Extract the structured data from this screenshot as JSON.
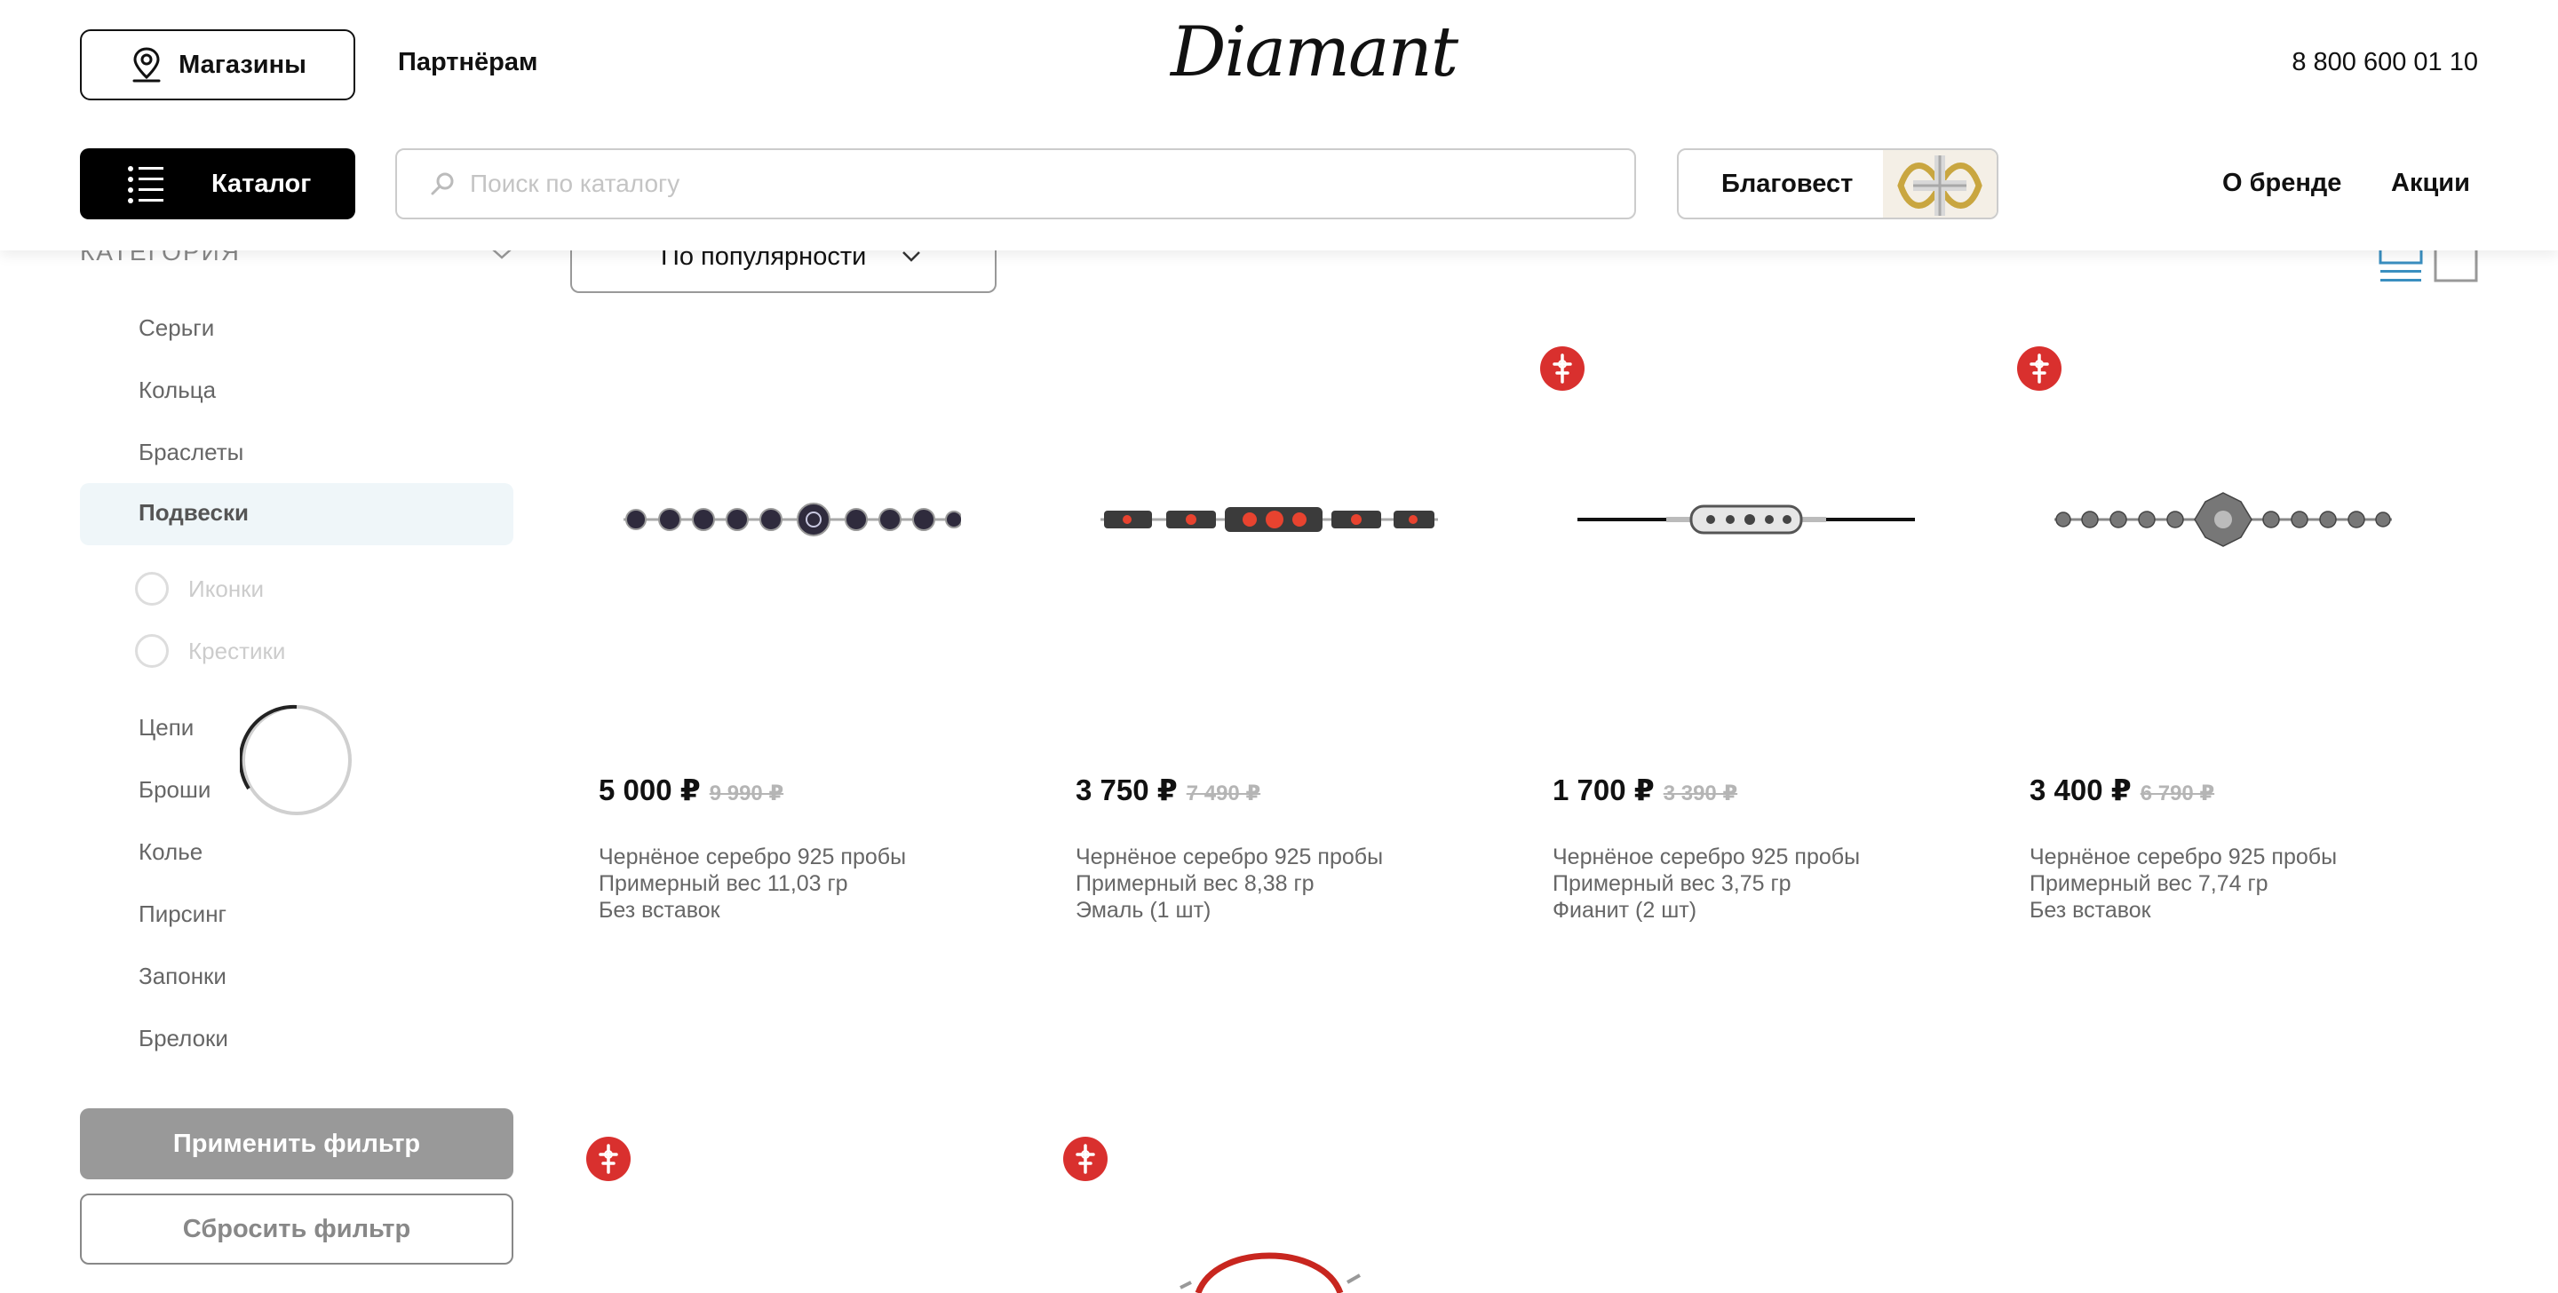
{
  "header": {
    "stores_label": "Магазины",
    "partners_label": "Партнёрам",
    "logo_text": "Diamant",
    "phone": "8 800 600 01 10",
    "catalog_label": "Каталог",
    "search_placeholder": "Поиск по каталогу",
    "promo_label": "Благовест",
    "nav": {
      "about": "О бренде",
      "sales": "Акции"
    }
  },
  "sidebar": {
    "heading": "КАТЕГОРИЯ",
    "categories": [
      "Серьги",
      "Кольца",
      "Браслеты"
    ],
    "active": "Подвески",
    "subcategories": [
      "Иконки",
      "Крестики"
    ],
    "more_categories": [
      "Цепи",
      "Броши",
      "Колье",
      "Пирсинг",
      "Запонки",
      "Брелоки"
    ],
    "apply_label": "Применить фильтр",
    "reset_label": "Сбросить фильтр"
  },
  "toolbar": {
    "sort_label": "По популярности"
  },
  "colors": {
    "badge": "#d9302e",
    "active_bg": "#eff6f9",
    "view_active": "#3a8fc0"
  },
  "products": [
    {
      "price": "5 000 ₽",
      "old_price": "9 990 ₽",
      "line1": "Чернёное серебро 925 пробы",
      "line2": "Примерный вес 11,03 гр",
      "line3": "Без вставок",
      "badge": false
    },
    {
      "price": "3 750 ₽",
      "old_price": "7 490 ₽",
      "line1": "Чернёное серебро 925 пробы",
      "line2": "Примерный вес 8,38 гр",
      "line3": "Эмаль (1 шт)",
      "badge": false
    },
    {
      "price": "1 700 ₽",
      "old_price": "3 390 ₽",
      "line1": "Чернёное серебро 925 пробы",
      "line2": "Примерный вес 3,75 гр",
      "line3": "Фианит (2 шт)",
      "badge": true
    },
    {
      "price": "3 400 ₽",
      "old_price": "6 790 ₽",
      "line1": "Чернёное серебро 925 пробы",
      "line2": "Примерный вес 7,74 гр",
      "line3": "Без вставок",
      "badge": true
    }
  ]
}
